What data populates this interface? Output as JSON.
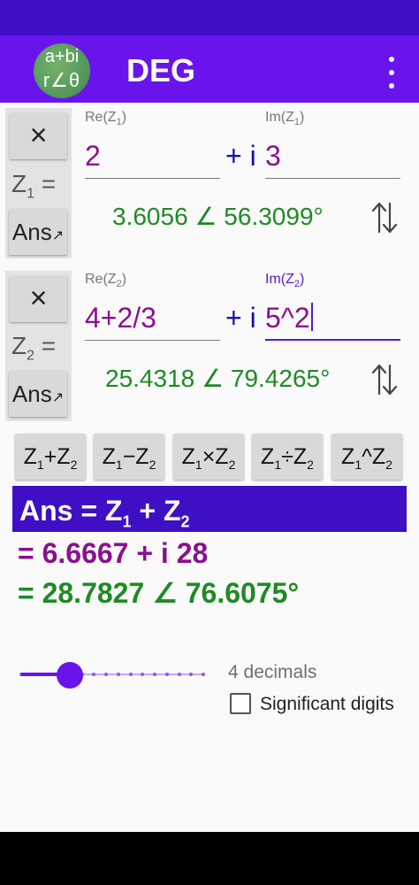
{
  "app": {
    "logo_line1": "a+bi",
    "logo_line2": "r∠θ",
    "mode": "DEG",
    "menu_icon": "more-vert-icon"
  },
  "z1": {
    "clear_label": "×",
    "label": "Z",
    "label_sub": "1",
    "label_eq": " =",
    "ans_label": "Ans",
    "ans_arrow": "↗",
    "re_label": "Re(Z",
    "re_label_sub": "1",
    "im_label": "Im(Z",
    "im_label_sub": "1",
    "label_close": ")",
    "re_value": "2",
    "plus_i": "+ i",
    "im_value": "3",
    "polar": "3.6056 ∠ 56.3099°",
    "swap_icon": "swap-vertical-icon"
  },
  "z2": {
    "clear_label": "×",
    "label": "Z",
    "label_sub": "2",
    "label_eq": " =",
    "ans_label": "Ans",
    "ans_arrow": "↗",
    "re_label": "Re(Z",
    "re_label_sub": "2",
    "im_label": "Im(Z",
    "im_label_sub": "2",
    "label_close": ")",
    "re_value": "4+2/3",
    "plus_i": "+ i",
    "im_value": "5^2",
    "polar": "25.4318 ∠ 79.4265°",
    "swap_icon": "swap-vertical-icon"
  },
  "operations": [
    {
      "a": "Z",
      "a_sub": "1",
      "op": "+",
      "b": "Z",
      "b_sub": "2"
    },
    {
      "a": "Z",
      "a_sub": "1",
      "op": "−",
      "b": "Z",
      "b_sub": "2"
    },
    {
      "a": "Z",
      "a_sub": "1",
      "op": "×",
      "b": "Z",
      "b_sub": "2"
    },
    {
      "a": "Z",
      "a_sub": "1",
      "op": "÷",
      "b": "Z",
      "b_sub": "2"
    },
    {
      "a": "Z",
      "a_sub": "1",
      "op": "^",
      "b": "Z",
      "b_sub": "2"
    }
  ],
  "result": {
    "header_prefix": "Ans = Z",
    "header_sub1": "1",
    "header_mid": " + Z",
    "header_sub2": "2",
    "rect": "= 6.6667 + i 28",
    "polar": "= 28.7827 ∠ 76.6075°"
  },
  "settings": {
    "decimals_value": 4,
    "decimals_max": 15,
    "decimals_label": "4 decimals",
    "significant_label": "Significant digits",
    "significant_checked": false
  },
  "colors": {
    "status_bar": "#3e0fc4",
    "app_bar": "#6a14ec",
    "rect_text": "#8a1090",
    "polar_text": "#1f8a24",
    "plus_i_text": "#1810a8"
  }
}
